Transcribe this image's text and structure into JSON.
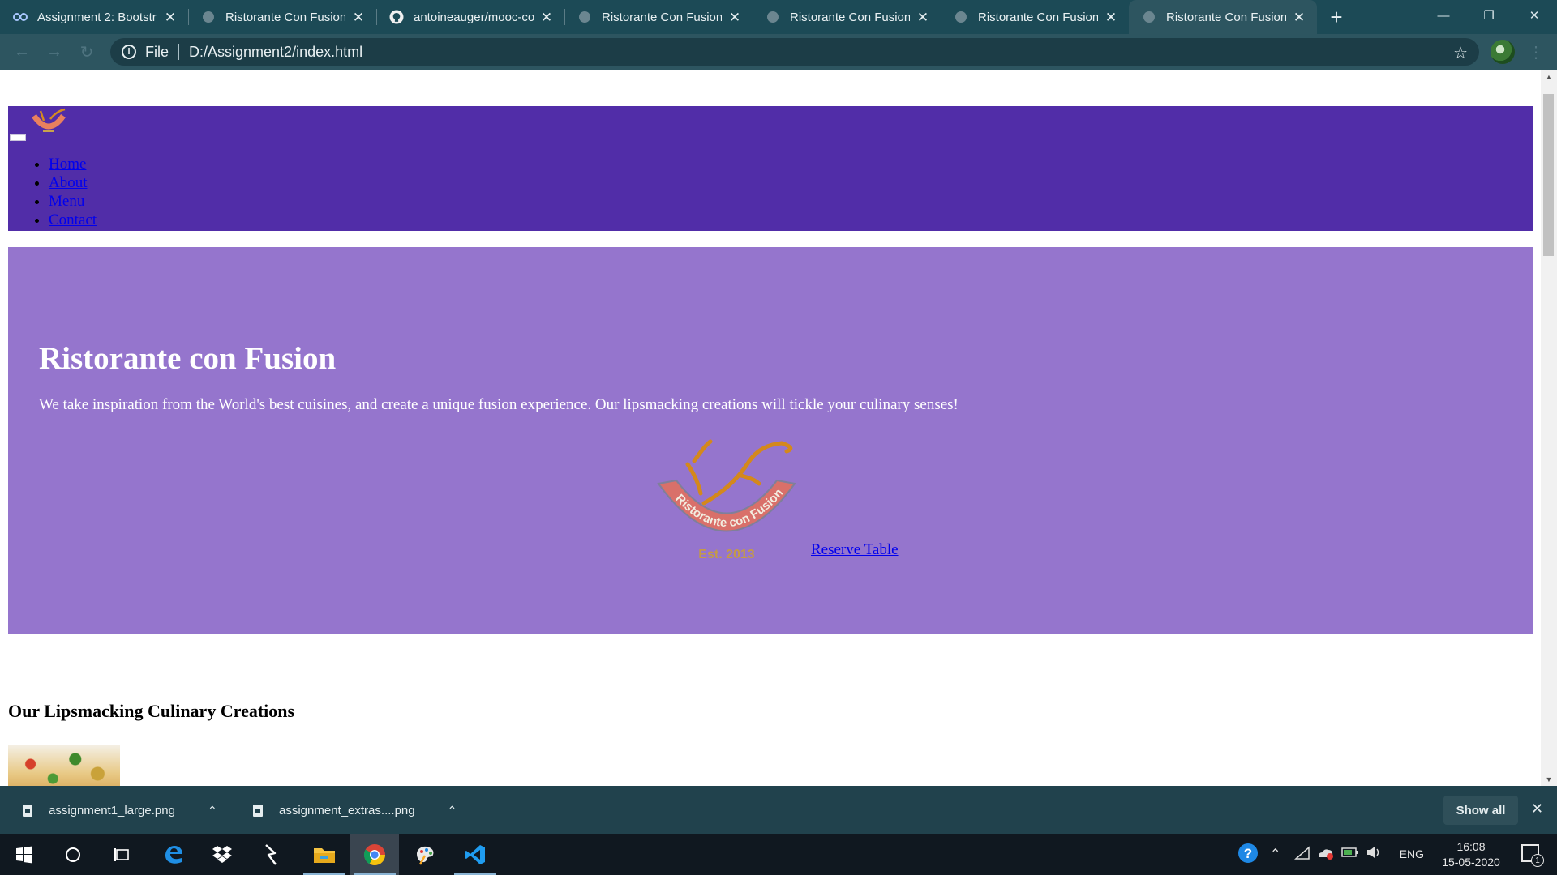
{
  "browser": {
    "tabs": [
      {
        "title": "Assignment 2: Bootstra",
        "favicon": "coursera-icon",
        "active": false
      },
      {
        "title": "Ristorante Con Fusion",
        "favicon": "globe-icon",
        "active": false
      },
      {
        "title": "antoineauger/mooc-co",
        "favicon": "github-icon",
        "active": false
      },
      {
        "title": "Ristorante Con Fusion:",
        "favicon": "globe-icon",
        "active": false
      },
      {
        "title": "Ristorante Con Fusion:",
        "favicon": "globe-icon",
        "active": false
      },
      {
        "title": "Ristorante Con Fusion",
        "favicon": "globe-icon",
        "active": false
      },
      {
        "title": "Ristorante Con Fusion",
        "favicon": "globe-icon",
        "active": true
      }
    ],
    "new_tab_symbol": "+",
    "address": {
      "scheme_label": "File",
      "url": "D:/Assignment2/index.html"
    }
  },
  "page": {
    "nav": {
      "items": [
        "Home",
        "About",
        "Menu",
        "Contact"
      ]
    },
    "jumbotron": {
      "title": "Ristorante con Fusion",
      "text": "We take inspiration from the World's best cuisines, and create a unique fusion experience. Our lipsmacking creations will tickle your culinary senses!",
      "logo_text": "Ristorante con Fusion",
      "logo_est": "Est. 2013",
      "reserve_label": "Reserve Table"
    },
    "section_title": "Our Lipsmacking Culinary Creations"
  },
  "downloads": {
    "items": [
      "assignment1_large.png",
      "assignment_extras....png"
    ],
    "show_all": "Show all"
  },
  "taskbar": {
    "language": "ENG",
    "time": "16:08",
    "date": "15-05-2020",
    "notification_count": "1"
  },
  "colors": {
    "navbar": "#512da8",
    "jumbotron": "#9575cd",
    "chrome_frame": "#1c4a56",
    "chrome_toolbar": "#2d5560"
  }
}
